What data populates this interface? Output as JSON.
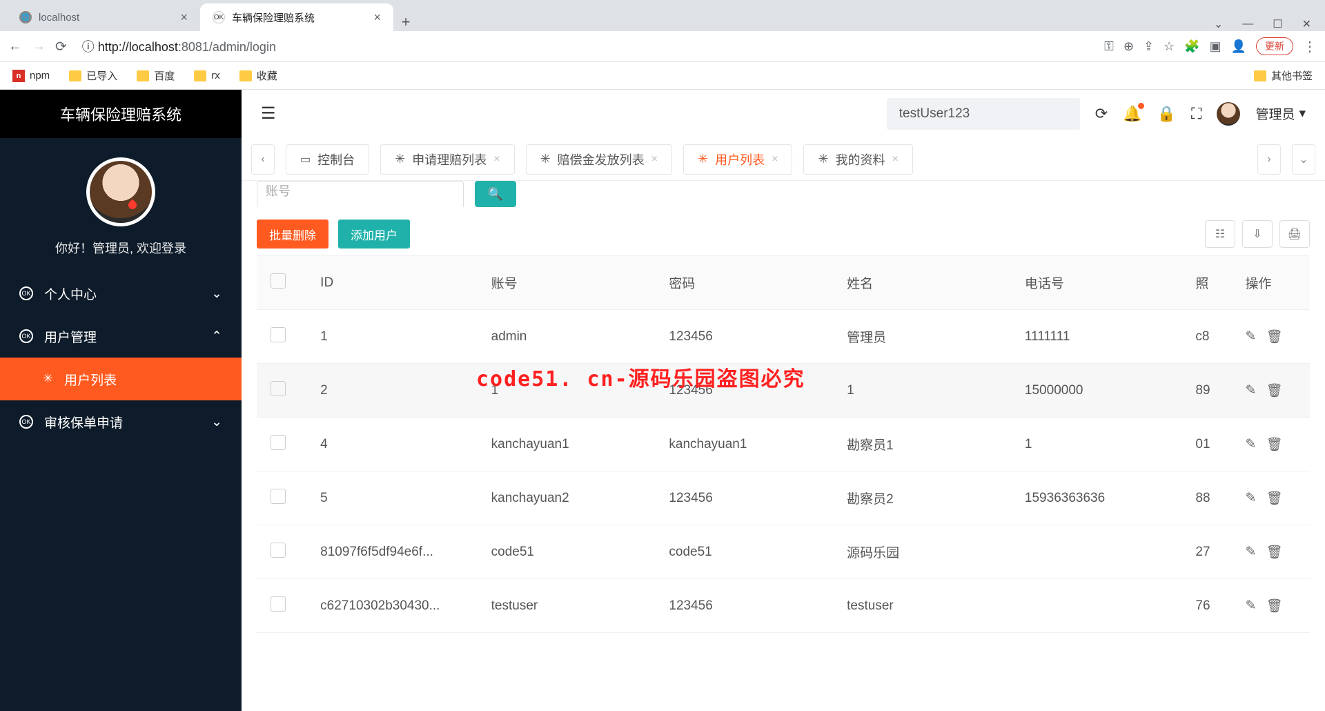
{
  "browser": {
    "tabs": [
      {
        "title": "localhost"
      },
      {
        "title": "车辆保险理赔系统"
      }
    ],
    "url_prefix": "ⓘ http://",
    "url_host": "localhost",
    "url_port": ":8081",
    "url_path": "/admin/login",
    "update_label": "更新",
    "bookmarks": [
      "npm",
      "已导入",
      "百度",
      "rx",
      "收藏"
    ],
    "other_bookmarks": "其他书签"
  },
  "app": {
    "title": "车辆保险理赔系统",
    "greeting": "你好！管理员, 欢迎登录",
    "search_value": "testUser123",
    "user_label": "管理员",
    "menu": {
      "personal": "个人中心",
      "user_mgmt": "用户管理",
      "user_list": "用户列表",
      "audit": "审核保单申请"
    },
    "page_tabs": {
      "console": "控制台",
      "apply": "申请理赔列表",
      "payout": "赔偿金发放列表",
      "users": "用户列表",
      "profile": "我的资料"
    },
    "partial_input": "账号",
    "actions": {
      "batch_delete": "批量删除",
      "add_user": "添加用户"
    },
    "columns": {
      "id": "ID",
      "account": "账号",
      "password": "密码",
      "name": "姓名",
      "phone": "电话号",
      "photo": "照",
      "ops": "操作"
    },
    "rows": [
      {
        "id": "1",
        "account": "admin",
        "password": "123456",
        "name": "管理员",
        "phone": "1111111",
        "photo": "c8"
      },
      {
        "id": "2",
        "account": "1",
        "password": "123456",
        "name": "1",
        "phone": "15000000",
        "photo": "89"
      },
      {
        "id": "4",
        "account": "kanchayuan1",
        "password": "kanchayuan1",
        "name": "勘察员1",
        "phone": "1",
        "photo": "01"
      },
      {
        "id": "5",
        "account": "kanchayuan2",
        "password": "123456",
        "name": "勘察员2",
        "phone": "15936363636",
        "photo": "88"
      },
      {
        "id": "81097f6f5df94e6f...",
        "account": "code51",
        "password": "code51",
        "name": "源码乐园",
        "phone": "",
        "photo": "27"
      },
      {
        "id": "c62710302b30430...",
        "account": "testuser",
        "password": "123456",
        "name": "testuser",
        "phone": "",
        "photo": "76"
      }
    ]
  },
  "watermark": "code51. cn-源码乐园盗图必究"
}
